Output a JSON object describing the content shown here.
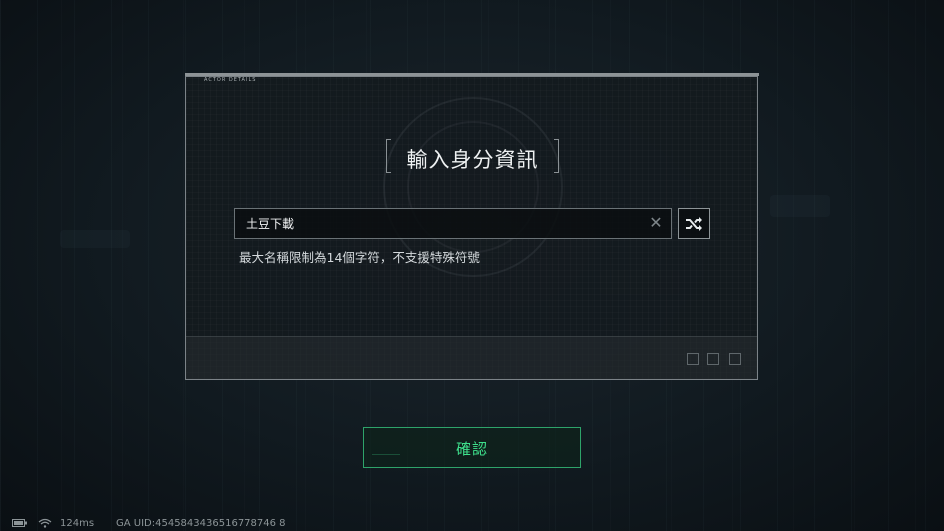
{
  "dialog": {
    "tag": "ACTOR DETAILS",
    "title": "輸入身分資訊",
    "name_input": {
      "value": "土豆下載",
      "placeholder": ""
    },
    "hint": "最大名稱限制為14個字符，不支援特殊符號",
    "clear_icon": "close-icon",
    "shuffle_icon": "shuffle-icon"
  },
  "confirm": {
    "label": "確認"
  },
  "status_bar": {
    "network_icon": "battery-icon",
    "wifi_icon": "wifi-icon",
    "ping": "124ms",
    "uid": "GA UID:4545843436516778746 8"
  },
  "colors": {
    "accent_green": "#3ee08c",
    "panel_border": "#7c8388",
    "background": "#111a20"
  }
}
